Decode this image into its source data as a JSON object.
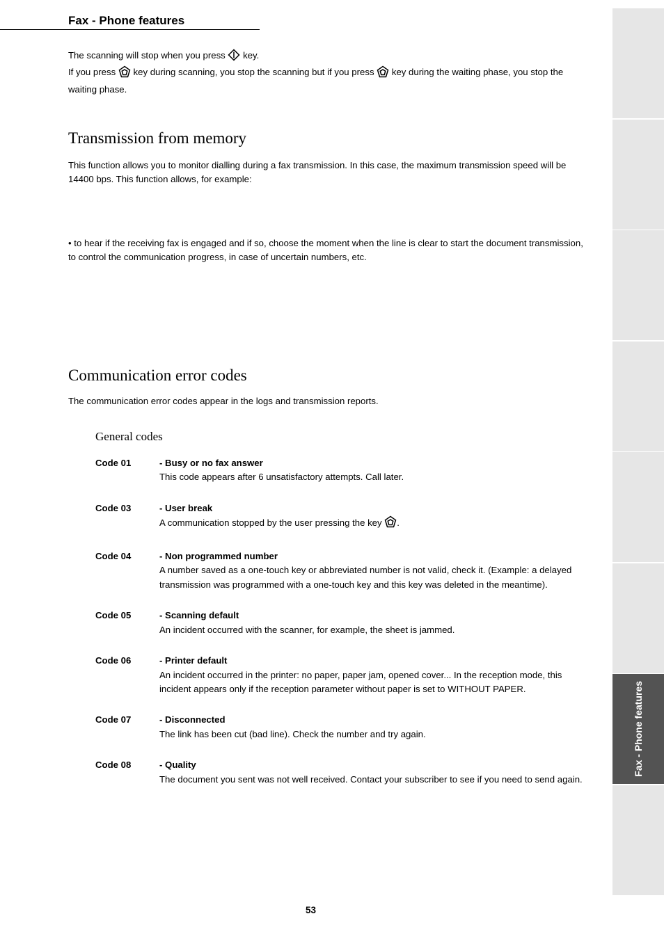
{
  "chapter_title": "Fax - Phone features",
  "intro": {
    "l1a": "The scanning will stop when you press ",
    "l1b": " key.",
    "l2a": "If you press ",
    "l2b": " key during scanning, you stop the scanning but if you press ",
    "l2c": " key during the waiting phase, you stop the waiting phase."
  },
  "h2_first": "Transmission from memory",
  "p1": "This function allows you to monitor dialling during a fax transmission. In this case, the maximum transmission speed will be 14400 bps. This function allows, for example:",
  "p2": "• to hear if the receiving fax is engaged and if so, choose the moment when the line is clear to start the document transmission, to control the communication progress, in case of uncertain numbers, etc.",
  "h2_second": "Communication error codes",
  "p3": "The communication error codes appear in the logs and transmission reports.",
  "h3": "General codes",
  "codes": [
    {
      "code": "Code 01",
      "bold_lead": "- Busy or no fax answer",
      "rest": "This code appears after 6 unsatisfactory attempts. Call later."
    },
    {
      "code": "Code 03",
      "bold_lead": "- User break",
      "rest_a": "A communication stopped by the user pressing the key ",
      "rest_b": "."
    },
    {
      "code": "Code 04",
      "bold_lead": "- Non programmed number",
      "rest": "A number saved as a one-touch key or abbreviated number is not valid, check it. (Example: a delayed transmission was programmed with a one-touch key and this key was deleted in the meantime)."
    },
    {
      "code": "Code 05",
      "bold_lead": "- Scanning default",
      "rest": "An incident occurred with the scanner, for example, the sheet is jammed."
    },
    {
      "code": "Code 06",
      "bold_lead": "- Printer default",
      "rest": "An incident occurred in the printer: no paper, paper jam, opened cover... In the reception mode, this incident appears only if the reception parameter without paper is set to WITHOUT PAPER."
    },
    {
      "code": "Code 07",
      "bold_lead": "- Disconnected",
      "rest": "The link has been cut (bad line). Check the number and try again."
    },
    {
      "code": "Code 08",
      "bold_lead": "- Quality",
      "rest": "The document you sent was not well received. Contact your subscriber to see if you need to send again."
    }
  ],
  "sidebar": [
    "",
    "",
    "",
    "",
    "",
    "",
    "Fax - Phone features",
    ""
  ],
  "page_number": "53"
}
